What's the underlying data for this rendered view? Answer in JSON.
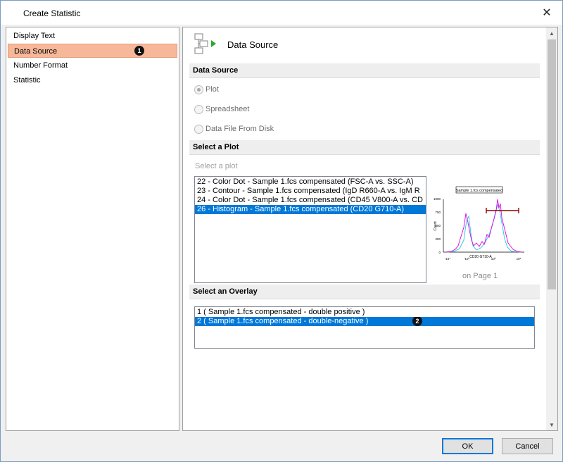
{
  "window": {
    "title": "Create Statistic",
    "close_glyph": "✕"
  },
  "nav": {
    "items": [
      {
        "label": "Display Text"
      },
      {
        "label": "Data Source",
        "badge": "1"
      },
      {
        "label": "Number Format"
      },
      {
        "label": "Statistic"
      }
    ]
  },
  "header": {
    "title": "Data Source",
    "icon": "data-source-icon"
  },
  "sections": {
    "data_source": "Data Source",
    "select_plot": "Select a Plot",
    "select_overlay": "Select an Overlay"
  },
  "data_source_options": [
    {
      "label": "Plot",
      "checked": true
    },
    {
      "label": "Spreadsheet",
      "checked": false
    },
    {
      "label": "Data File From Disk",
      "checked": false
    }
  ],
  "plot_hint": "Select a plot",
  "plots": [
    "22 - Color Dot - Sample 1.fcs compensated (FSC-A vs. SSC-A)",
    "23 - Contour - Sample 1.fcs compensated (IgD R660-A vs. IgM R",
    "24 - Color Dot - Sample 1.fcs compensated (CD45 V800-A vs. CD",
    "26 - Histogram - Sample 1.fcs compensated (CD20 G710-A)"
  ],
  "selected_plot_index": 3,
  "preview": {
    "title": "Sample 1.fcs compensated",
    "ylabel": "Count",
    "xlabel": "CD20 G710-A",
    "yticks": [
      "1000",
      "750",
      "500",
      "250",
      "0"
    ],
    "xticks": [
      "-10⁴",
      "-10³",
      "10³",
      "10⁵"
    ],
    "page_label": "on Page 1"
  },
  "overlays": [
    "1 ( Sample 1.fcs compensated - double positive )",
    "2 ( Sample 1.fcs compensated - double-negative )"
  ],
  "overlay_badge": "2",
  "buttons": {
    "ok": "OK",
    "cancel": "Cancel"
  },
  "colors": {
    "selection": "#0078d7",
    "nav_selected": "#f7b89a",
    "hist1": "#e000e0",
    "hist2": "#20c8e8",
    "gate": "#8b0000"
  }
}
